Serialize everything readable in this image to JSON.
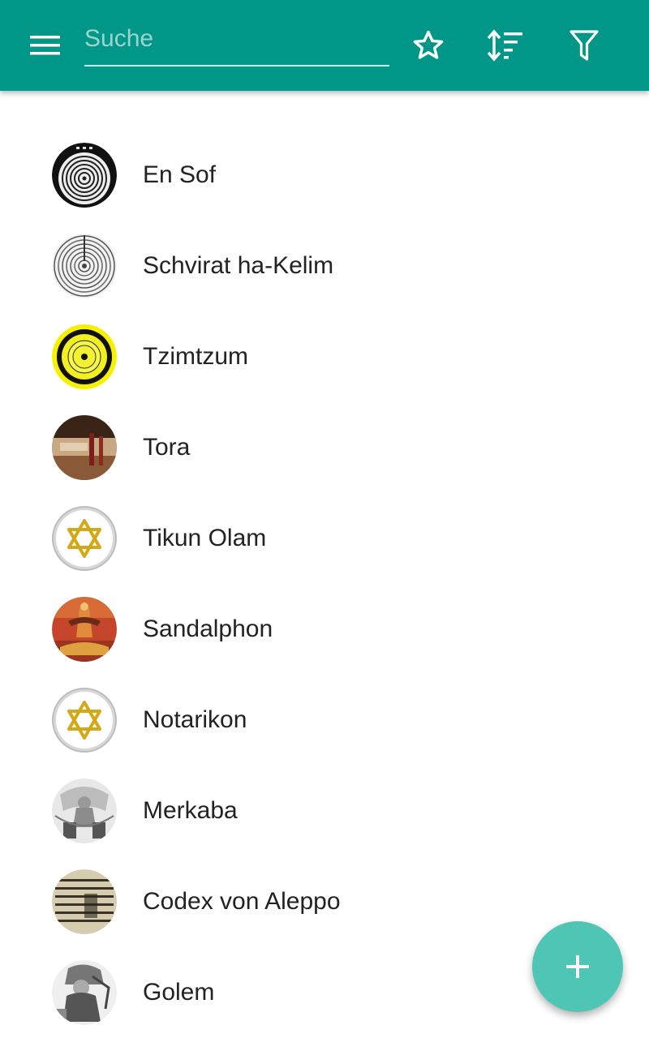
{
  "appbar": {
    "search_placeholder": "Suche",
    "search_value": "",
    "icons": [
      "menu-icon",
      "star-icon",
      "sort-icon",
      "filter-icon"
    ],
    "color": "#009688"
  },
  "list": {
    "items": [
      {
        "label": "En Sof",
        "avatar": "en-sof-avatar"
      },
      {
        "label": "Schvirat ha-Kelim",
        "avatar": "schvirat-avatar"
      },
      {
        "label": "Tzimtzum",
        "avatar": "tzimtzum-avatar"
      },
      {
        "label": "Tora",
        "avatar": "tora-avatar"
      },
      {
        "label": "Tikun Olam",
        "avatar": "star-of-david-avatar"
      },
      {
        "label": "Sandalphon",
        "avatar": "sandalphon-avatar"
      },
      {
        "label": "Notarikon",
        "avatar": "star-of-david-avatar"
      },
      {
        "label": "Merkaba",
        "avatar": "merkaba-avatar"
      },
      {
        "label": "Codex von Aleppo",
        "avatar": "codex-avatar"
      },
      {
        "label": "Golem",
        "avatar": "golem-avatar"
      }
    ]
  },
  "fab": {
    "icon": "plus-icon",
    "color": "#4fc5b5"
  }
}
